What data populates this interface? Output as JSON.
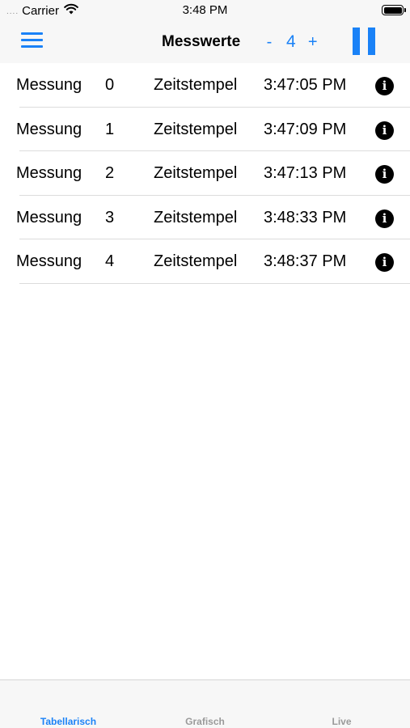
{
  "status_bar": {
    "signal_dots": "....",
    "carrier": "Carrier",
    "time": "3:48 PM"
  },
  "nav": {
    "title": "Messwerte",
    "stepper_minus": "-",
    "stepper_value": "4",
    "stepper_plus": "+",
    "accent_color": "#1a82f7"
  },
  "measurements": [
    {
      "label": "Messung",
      "index": "0",
      "timestamp_label": "Zeitstempel",
      "time": "3:47:05 PM",
      "info": "i"
    },
    {
      "label": "Messung",
      "index": "1",
      "timestamp_label": "Zeitstempel",
      "time": "3:47:09 PM",
      "info": "i"
    },
    {
      "label": "Messung",
      "index": "2",
      "timestamp_label": "Zeitstempel",
      "time": "3:47:13 PM",
      "info": "i"
    },
    {
      "label": "Messung",
      "index": "3",
      "timestamp_label": "Zeitstempel",
      "time": "3:48:33 PM",
      "info": "i"
    },
    {
      "label": "Messung",
      "index": "4",
      "timestamp_label": "Zeitstempel",
      "time": "3:48:37 PM",
      "info": "i"
    }
  ],
  "tabs": [
    {
      "label": "Tabellarisch",
      "active": true
    },
    {
      "label": "Grafisch",
      "active": false
    },
    {
      "label": "Live",
      "active": false
    }
  ],
  "icons": {
    "menu": "hamburger-menu-icon",
    "pause": "pause-icon",
    "info": "info-icon",
    "wifi": "wifi-icon",
    "battery": "battery-icon"
  }
}
